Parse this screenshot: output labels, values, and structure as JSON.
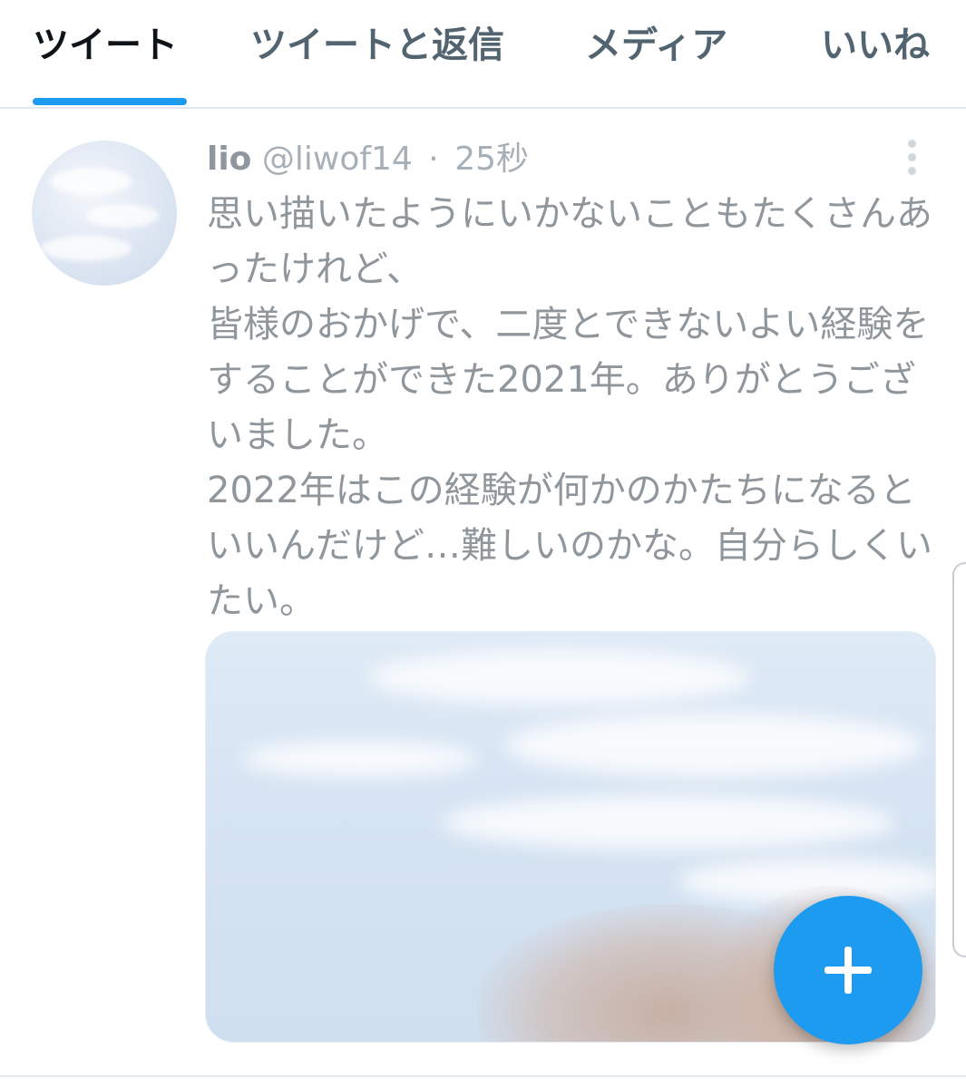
{
  "tabs": [
    {
      "label": "ツイート",
      "active": true
    },
    {
      "label": "ツイートと返信",
      "active": false
    },
    {
      "label": "メディア",
      "active": false
    },
    {
      "label": "いいね",
      "active": false
    }
  ],
  "accent_color": "#1d9bf0",
  "tweet": {
    "display_name": "lio",
    "handle": "@liwof14",
    "separator": "·",
    "time": "25秒",
    "text": "思い描いたようにいかないこともたくさんあったけれど、\n皆様のおかげで、二度とできないよい経験をすることができた2021年。ありがとうございました。\n2022年はこの経験が何かのかたちになるといいんだけど…難しいのかな。自分らしくいたい。",
    "more_icon": "vertical-dots-icon",
    "media": "sky-photo"
  },
  "fab": {
    "icon": "plus-icon"
  }
}
